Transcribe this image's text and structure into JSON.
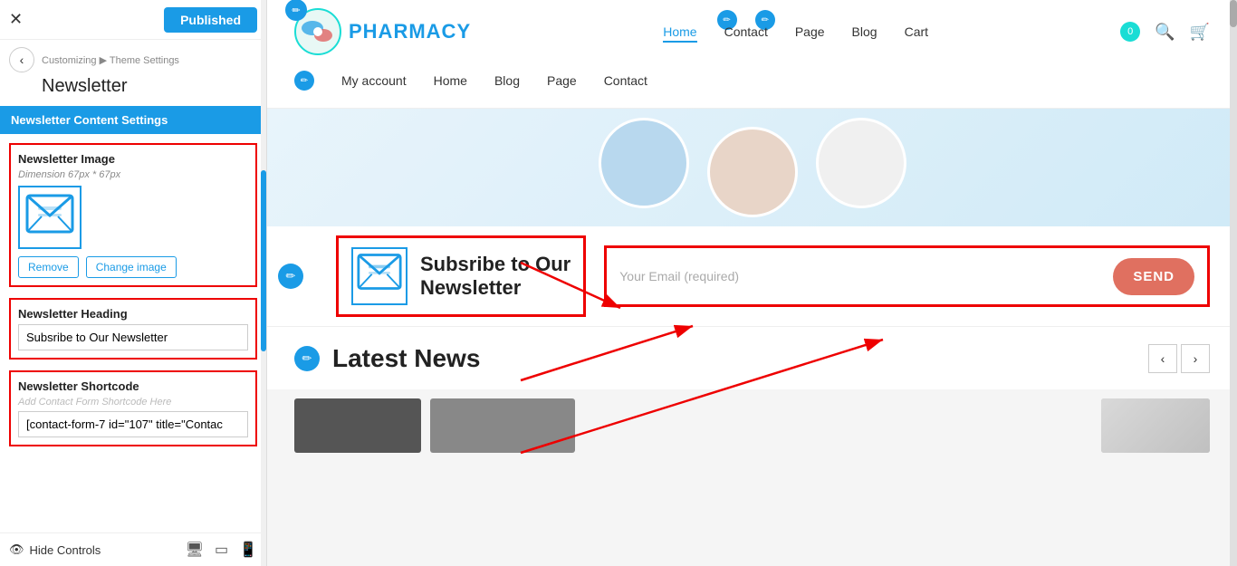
{
  "leftPanel": {
    "closeBtn": "✕",
    "publishedBtn": "Published",
    "backBtn": "‹",
    "breadcrumb": "Customizing ▶ Theme Settings",
    "title": "Newsletter",
    "sectionHeader": "Newsletter Content Settings",
    "imageField": {
      "label": "Newsletter Image",
      "sublabel": "Dimension 67px * 67px",
      "removeBtn": "Remove",
      "changeBtn": "Change image"
    },
    "headingField": {
      "label": "Newsletter Heading",
      "value": "Subsribe to Our Newsletter"
    },
    "shortcodeField": {
      "label": "Newsletter Shortcode",
      "placeholder": "Add Contact Form Shortcode Here",
      "value": "[contact-form-7 id=\"107\" title=\"Contac"
    },
    "hideControls": "Hide Controls"
  },
  "siteHeader": {
    "logoText": "PHARMACY",
    "navLinks": [
      "Home",
      "Contact",
      "Page",
      "Blog",
      "Cart"
    ],
    "navLinks2": [
      "My account",
      "Home",
      "Blog",
      "Page",
      "Contact"
    ],
    "cartCount": "0"
  },
  "newsletter": {
    "heading1": "Subsribe to Our",
    "heading2": "Newsletter",
    "emailPlaceholder": "Your Email (required)",
    "sendBtn": "SEND"
  },
  "latestNews": {
    "title": "Latest News",
    "prevBtn": "‹",
    "nextBtn": "›"
  }
}
